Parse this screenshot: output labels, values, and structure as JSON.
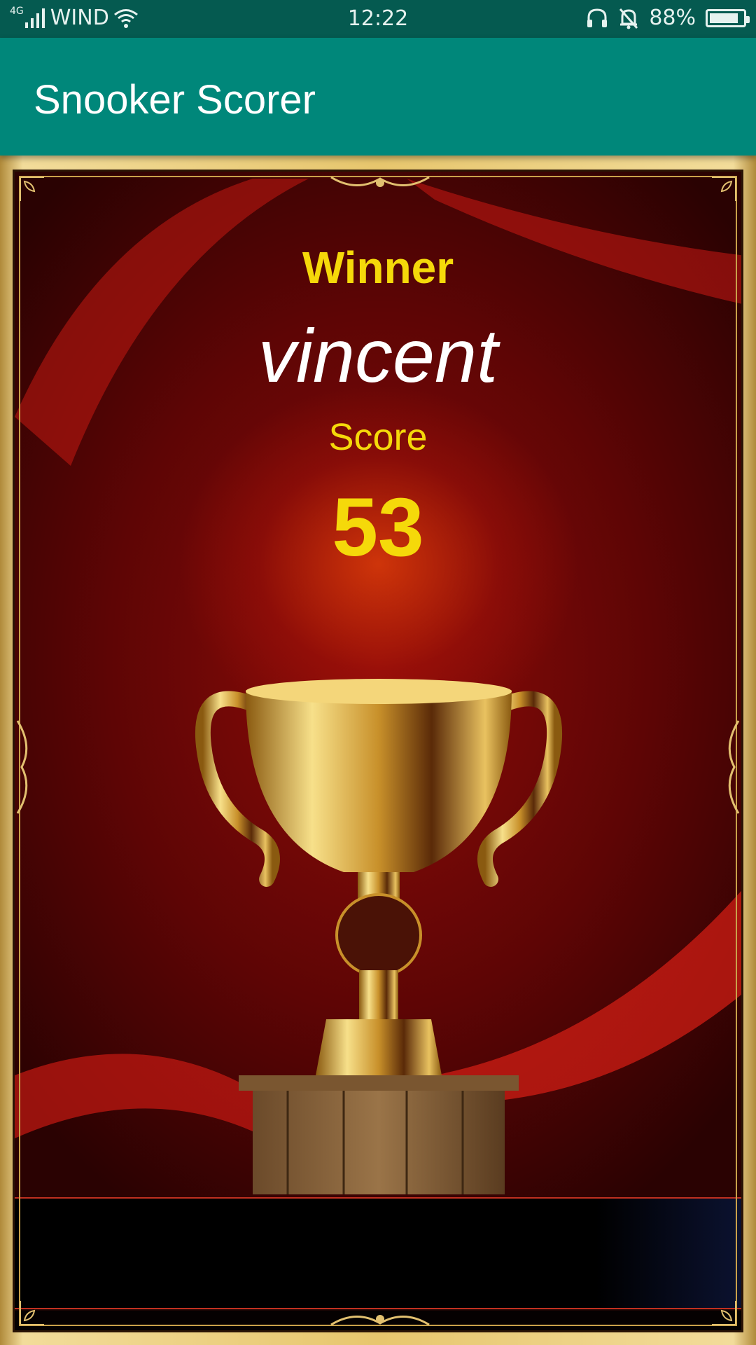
{
  "status_bar": {
    "network_type": "4G",
    "carrier": "WIND",
    "time": "12:22",
    "battery_percent": "88%",
    "battery_level": 0.88,
    "icons": [
      "signal-icon",
      "wifi-icon",
      "headset-icon",
      "bell-muted-icon",
      "battery-icon"
    ]
  },
  "app_bar": {
    "title": "Snooker Scorer",
    "background_color": "#00877a"
  },
  "result": {
    "winner_label": "Winner",
    "winner_name": "vincent",
    "score_label": "Score",
    "score_value": "53",
    "text_color": "#f5d90a"
  },
  "artwork": {
    "subject": "trophy-image"
  }
}
